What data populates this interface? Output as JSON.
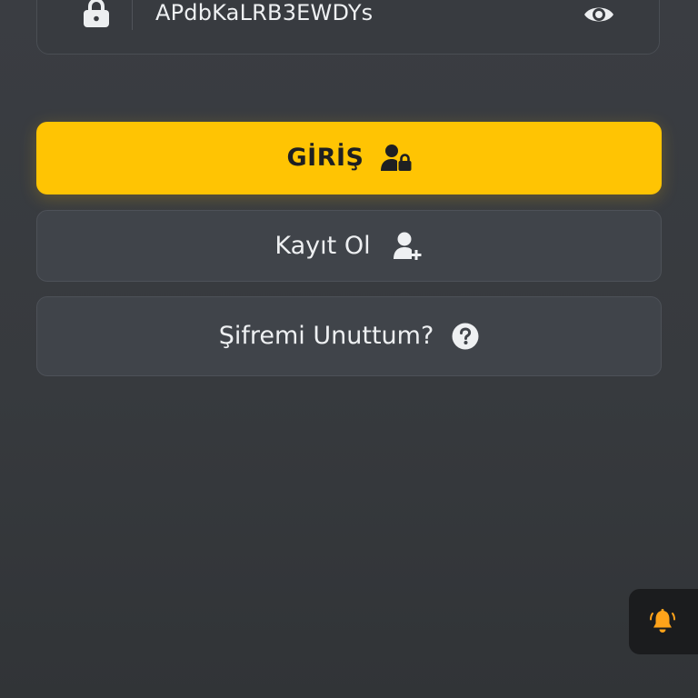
{
  "password_field": {
    "value": "APdbKaLRB3EWDYs",
    "lock_icon": "lock-icon",
    "visibility_icon": "eye-icon"
  },
  "buttons": {
    "login": {
      "label": "GİRİŞ",
      "icon": "user-lock-icon",
      "color": "#ffc403"
    },
    "register": {
      "label": "Kayıt Ol",
      "icon": "user-plus-icon"
    },
    "forgot": {
      "label": "Şifremi Unuttum?",
      "icon": "question-circle-icon"
    }
  },
  "notification": {
    "icon": "bell-ringing-icon",
    "color": "#ffa31a"
  }
}
